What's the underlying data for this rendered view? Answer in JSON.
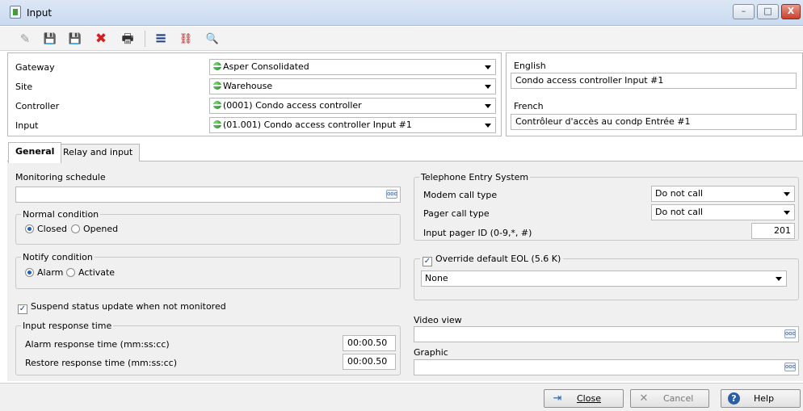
{
  "window": {
    "title": "Input",
    "minimize": "–",
    "maximize": "□",
    "close": "X"
  },
  "toolbar": {
    "icons": [
      "new-icon",
      "save-icon",
      "save-as-icon",
      "delete-icon",
      "print-icon",
      "list-icon",
      "links-icon",
      "search-icon"
    ],
    "glyphs": {
      "new": "✎",
      "save": "💾",
      "save_as": "💾",
      "delete": "✖",
      "print": "🖶",
      "list": "≡",
      "links": "⛓",
      "search": "🔍"
    }
  },
  "form": {
    "gateway": {
      "label": "Gateway",
      "value": "Asper Consolidated"
    },
    "site": {
      "label": "Site",
      "value": "Warehouse"
    },
    "controller": {
      "label": "Controller",
      "value": "(0001) Condo access controller"
    },
    "input": {
      "label": "Input",
      "value": "(01.001) Condo access controller Input #1"
    }
  },
  "names": {
    "english_label": "English",
    "english_value": "Condo access controller Input #1",
    "french_label": "French",
    "french_value": "Contrôleur d'accès au condp Entrée #1"
  },
  "tabs": [
    {
      "label": "General",
      "active": true
    },
    {
      "label": "Relay and input",
      "active": false
    }
  ],
  "general": {
    "monitoring_schedule_label": "Monitoring schedule",
    "monitoring_schedule_value": "",
    "normal_condition": {
      "label": "Normal condition",
      "options": [
        "Closed",
        "Opened"
      ],
      "selected": "Closed"
    },
    "notify_condition": {
      "label": "Notify condition",
      "options": [
        "Alarm",
        "Activate"
      ],
      "selected": "Alarm"
    },
    "suspend_label": "Suspend status update when not monitored",
    "suspend_checked": true,
    "response_time": {
      "label": "Input response time",
      "alarm_label": "Alarm response time (mm:ss:cc)",
      "alarm_value": "00:00.50",
      "restore_label": "Restore response time (mm:ss:cc)",
      "restore_value": "00:00.50"
    },
    "telephone": {
      "label": "Telephone Entry System",
      "modem_label": "Modem call type",
      "modem_value": "Do not call",
      "pager_label": "Pager call type",
      "pager_value": "Do not call",
      "pager_id_label": "Input pager ID (0-9,*, #)",
      "pager_id_value": "201"
    },
    "eol": {
      "label": "Override default EOL (5.6 K)",
      "checked": true,
      "value": "None"
    },
    "video_view_label": "Video view",
    "video_view_value": "",
    "graphic_label": "Graphic",
    "graphic_value": ""
  },
  "buttons": {
    "close": "Close",
    "cancel": "Cancel",
    "help": "Help"
  },
  "colors": {
    "status_green": "#0d7a12",
    "delete_red": "#d42020",
    "accent_blue": "#1f5fc0"
  }
}
